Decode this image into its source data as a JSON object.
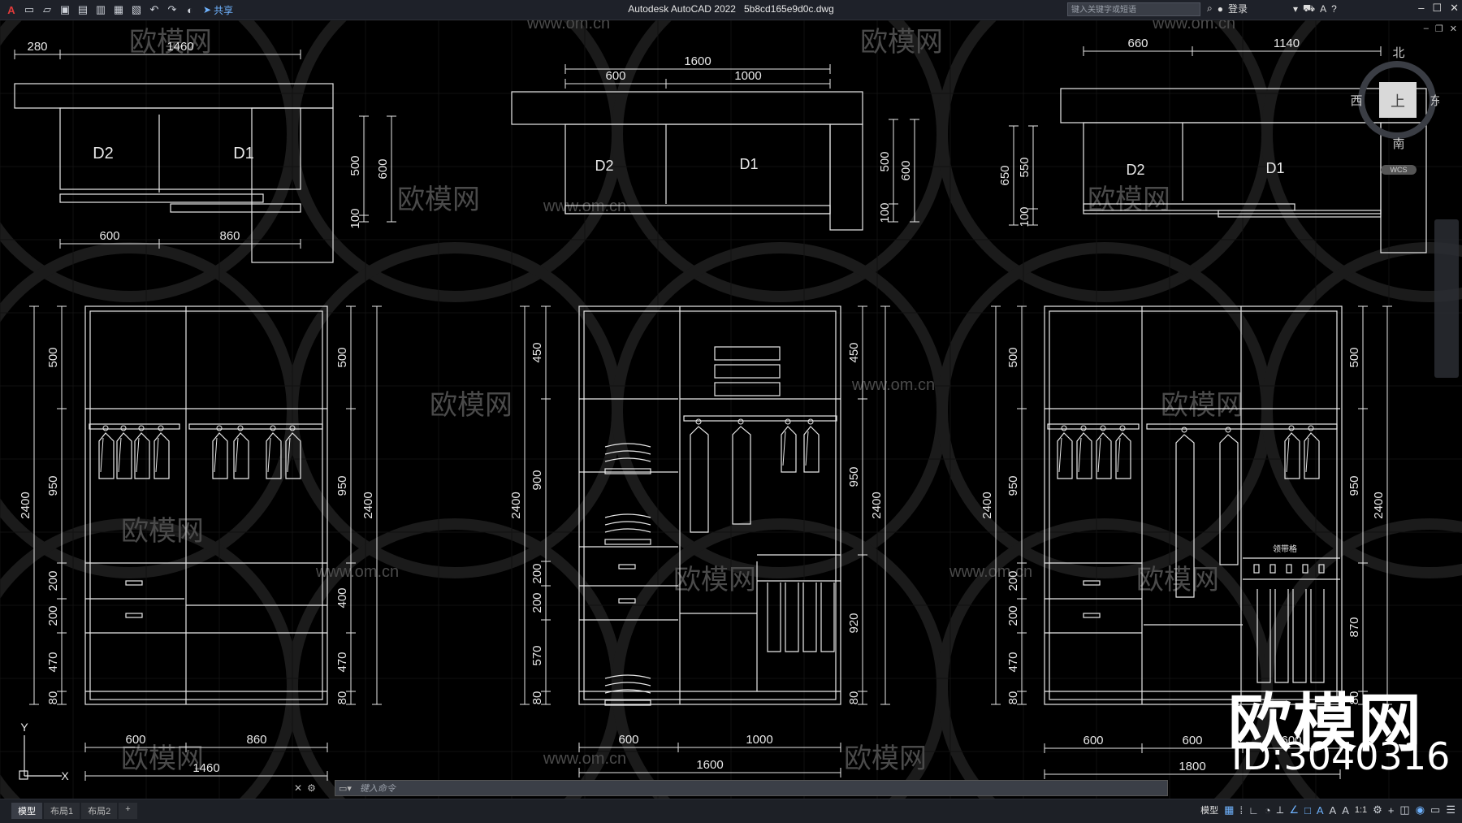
{
  "titlebar": {
    "app_name": "Autodesk AutoCAD 2022",
    "file_name": "5b8cd165e9d0c.dwg",
    "share_label": "共享",
    "search_placeholder": "键入关键字或短语",
    "login_label": "登录",
    "help_icon": "?"
  },
  "viewcube": {
    "north": "北",
    "south": "南",
    "east": "东",
    "west": "西",
    "top": "上",
    "wcs": "WCS"
  },
  "command_line": {
    "placeholder": "键入命令"
  },
  "status_bar": {
    "tabs": [
      "模型",
      "布局1",
      "布局2"
    ],
    "add_tab": "+",
    "model_label": "模型",
    "scale_label": "1:1"
  },
  "watermark": {
    "logo_text": "欧模网",
    "site_text": "www.om.cn",
    "id_text": "ID:3040316"
  },
  "drawing": {
    "plan_left": {
      "dims_top": [
        "280",
        "1460"
      ],
      "dims_bottom": [
        "600",
        "860"
      ],
      "dims_right": [
        "500",
        "600",
        "100"
      ],
      "labels": [
        "D2",
        "D1"
      ]
    },
    "plan_middle": {
      "dims_top": [
        "1600",
        "600",
        "1000"
      ],
      "dims_right": [
        "500",
        "600",
        "100"
      ],
      "labels": [
        "D2",
        "D1"
      ]
    },
    "plan_right": {
      "dims_top": [
        "660",
        "1140"
      ],
      "dims_left": [
        "650",
        "550",
        "100"
      ],
      "labels": [
        "D2",
        "D1"
      ]
    },
    "elev_left": {
      "dims_left": [
        "500",
        "950",
        "200",
        "200",
        "470",
        "80",
        "2400"
      ],
      "dims_right": [
        "500",
        "950",
        "400",
        "470",
        "80",
        "2400"
      ],
      "dims_bottom": [
        "600",
        "860",
        "1460"
      ]
    },
    "elev_middle": {
      "dims_left": [
        "450",
        "900",
        "200",
        "200",
        "570",
        "80",
        "2400"
      ],
      "dims_right": [
        "450",
        "950",
        "920",
        "80",
        "2400"
      ],
      "dims_bottom": [
        "600",
        "1000",
        "1600"
      ]
    },
    "elev_right": {
      "dims_left": [
        "500",
        "950",
        "200",
        "200",
        "470",
        "80",
        "2400"
      ],
      "dims_right": [
        "500",
        "950",
        "870",
        "80",
        "2400"
      ],
      "dims_bottom": [
        "600",
        "600",
        "600",
        "1800"
      ],
      "tie_rack_label": "领带格"
    }
  }
}
